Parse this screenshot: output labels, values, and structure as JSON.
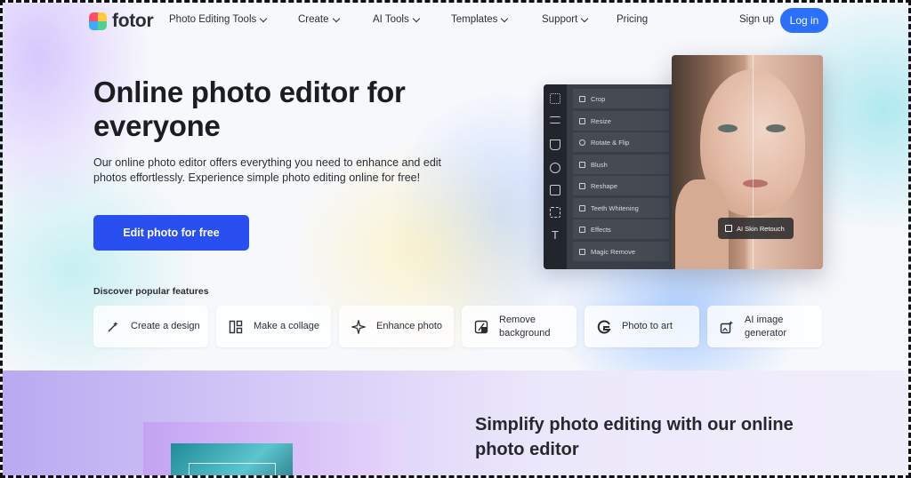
{
  "nav": {
    "logo": "fotor",
    "items": [
      {
        "label": "Photo Editing Tools",
        "dropdown": true
      },
      {
        "label": "Create",
        "dropdown": true
      },
      {
        "label": "AI Tools",
        "dropdown": true
      },
      {
        "label": "Templates",
        "dropdown": true
      },
      {
        "label": "Support",
        "dropdown": true
      },
      {
        "label": "Pricing",
        "dropdown": false
      }
    ],
    "signup": "Sign up",
    "login": "Log in"
  },
  "hero": {
    "title": "Online photo editor for everyone",
    "description": "Our online photo editor offers everything you need to enhance and edit photos effortlessly. Experience simple photo editing online for free!",
    "cta": "Edit photo for free"
  },
  "editor": {
    "menu": [
      "Crop",
      "Resize",
      "Rotate & Flip",
      "Blush",
      "Reshape",
      "Teeth Whitening",
      "Effects",
      "Magic Remove"
    ],
    "badge": "AI Skin Retouch"
  },
  "features": {
    "title": "Discover popular features",
    "cards": [
      {
        "label": "Create a design",
        "icon": "magic-wand-icon"
      },
      {
        "label": "Make a collage",
        "icon": "collage-icon"
      },
      {
        "label": "Enhance photo",
        "icon": "sparkle-icon"
      },
      {
        "label": "Remove background",
        "icon": "remove-bg-icon"
      },
      {
        "label": "Photo to art",
        "icon": "art-icon"
      },
      {
        "label": "AI image generator",
        "icon": "ai-generator-icon"
      }
    ]
  },
  "section2": {
    "title": "Simplify photo editing with our online photo editor"
  },
  "colors": {
    "primary": "#2a4ff0",
    "login": "#2b6fff"
  }
}
